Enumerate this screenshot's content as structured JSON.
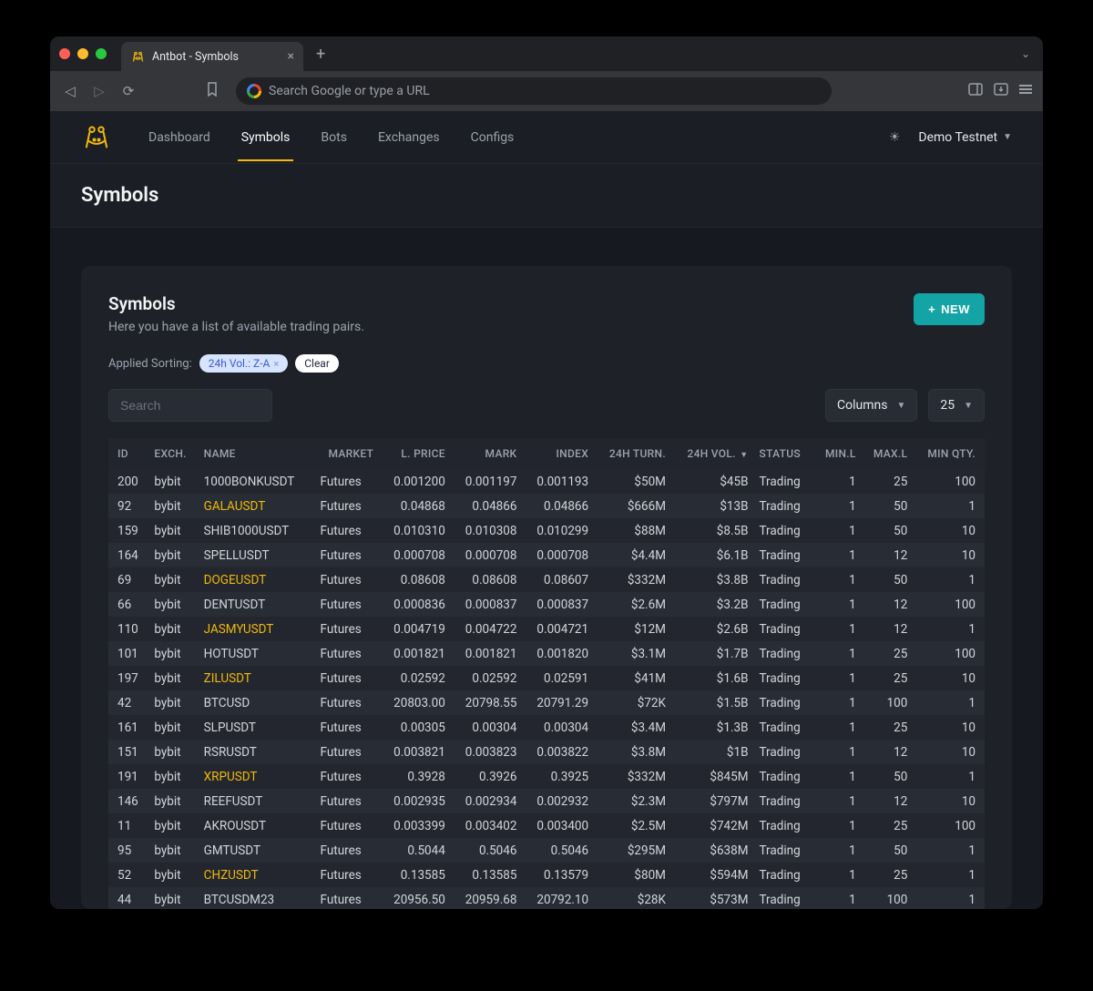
{
  "chrome": {
    "tab_title": "Antbot - Symbols",
    "omnibox_placeholder": "Search Google or type a URL"
  },
  "nav": {
    "items": [
      "Dashboard",
      "Symbols",
      "Bots",
      "Exchanges",
      "Configs"
    ],
    "active_index": 1,
    "user": "Demo Testnet"
  },
  "page": {
    "title": "Symbols",
    "card_title": "Symbols",
    "card_subtitle": "Here you have a list of available trading pairs.",
    "new_button": "NEW",
    "applied_sorting_label": "Applied Sorting:",
    "sort_pill": "24h Vol.: Z-A",
    "clear_pill": "Clear",
    "search_placeholder": "Search",
    "columns_label": "Columns",
    "page_size": "25"
  },
  "table": {
    "columns": [
      "ID",
      "EXCH.",
      "NAME",
      "MARKET",
      "L. PRICE",
      "MARK",
      "INDEX",
      "24H TURN.",
      "24H VOL.",
      "STATUS",
      "MIN.L",
      "MAX.L",
      "MIN QTY."
    ],
    "sorted_column_index": 8,
    "rows": [
      {
        "id": "200",
        "exch": "bybit",
        "name": "1000BONKUSDT",
        "hl": false,
        "market": "Futures",
        "lprice": "0.001200",
        "mark": "0.001197",
        "index": "0.001193",
        "turn": "$50M",
        "vol": "$45B",
        "status": "Trading",
        "minl": "1",
        "maxl": "25",
        "minqty": "100"
      },
      {
        "id": "92",
        "exch": "bybit",
        "name": "GALAUSDT",
        "hl": true,
        "market": "Futures",
        "lprice": "0.04868",
        "mark": "0.04866",
        "index": "0.04866",
        "turn": "$666M",
        "vol": "$13B",
        "status": "Trading",
        "minl": "1",
        "maxl": "50",
        "minqty": "1"
      },
      {
        "id": "159",
        "exch": "bybit",
        "name": "SHIB1000USDT",
        "hl": false,
        "market": "Futures",
        "lprice": "0.010310",
        "mark": "0.010308",
        "index": "0.010299",
        "turn": "$88M",
        "vol": "$8.5B",
        "status": "Trading",
        "minl": "1",
        "maxl": "50",
        "minqty": "10"
      },
      {
        "id": "164",
        "exch": "bybit",
        "name": "SPELLUSDT",
        "hl": false,
        "market": "Futures",
        "lprice": "0.000708",
        "mark": "0.000708",
        "index": "0.000708",
        "turn": "$4.4M",
        "vol": "$6.1B",
        "status": "Trading",
        "minl": "1",
        "maxl": "12",
        "minqty": "10"
      },
      {
        "id": "69",
        "exch": "bybit",
        "name": "DOGEUSDT",
        "hl": true,
        "market": "Futures",
        "lprice": "0.08608",
        "mark": "0.08608",
        "index": "0.08607",
        "turn": "$332M",
        "vol": "$3.8B",
        "status": "Trading",
        "minl": "1",
        "maxl": "50",
        "minqty": "1"
      },
      {
        "id": "66",
        "exch": "bybit",
        "name": "DENTUSDT",
        "hl": false,
        "market": "Futures",
        "lprice": "0.000836",
        "mark": "0.000837",
        "index": "0.000837",
        "turn": "$2.6M",
        "vol": "$3.2B",
        "status": "Trading",
        "minl": "1",
        "maxl": "12",
        "minqty": "100"
      },
      {
        "id": "110",
        "exch": "bybit",
        "name": "JASMYUSDT",
        "hl": true,
        "market": "Futures",
        "lprice": "0.004719",
        "mark": "0.004722",
        "index": "0.004721",
        "turn": "$12M",
        "vol": "$2.6B",
        "status": "Trading",
        "minl": "1",
        "maxl": "12",
        "minqty": "1"
      },
      {
        "id": "101",
        "exch": "bybit",
        "name": "HOTUSDT",
        "hl": false,
        "market": "Futures",
        "lprice": "0.001821",
        "mark": "0.001821",
        "index": "0.001820",
        "turn": "$3.1M",
        "vol": "$1.7B",
        "status": "Trading",
        "minl": "1",
        "maxl": "25",
        "minqty": "100"
      },
      {
        "id": "197",
        "exch": "bybit",
        "name": "ZILUSDT",
        "hl": true,
        "market": "Futures",
        "lprice": "0.02592",
        "mark": "0.02592",
        "index": "0.02591",
        "turn": "$41M",
        "vol": "$1.6B",
        "status": "Trading",
        "minl": "1",
        "maxl": "25",
        "minqty": "10"
      },
      {
        "id": "42",
        "exch": "bybit",
        "name": "BTCUSD",
        "hl": false,
        "market": "Futures",
        "lprice": "20803.00",
        "mark": "20798.55",
        "index": "20791.29",
        "turn": "$72K",
        "vol": "$1.5B",
        "status": "Trading",
        "minl": "1",
        "maxl": "100",
        "minqty": "1"
      },
      {
        "id": "161",
        "exch": "bybit",
        "name": "SLPUSDT",
        "hl": false,
        "market": "Futures",
        "lprice": "0.00305",
        "mark": "0.00304",
        "index": "0.00304",
        "turn": "$3.4M",
        "vol": "$1.3B",
        "status": "Trading",
        "minl": "1",
        "maxl": "25",
        "minqty": "10"
      },
      {
        "id": "151",
        "exch": "bybit",
        "name": "RSRUSDT",
        "hl": false,
        "market": "Futures",
        "lprice": "0.003821",
        "mark": "0.003823",
        "index": "0.003822",
        "turn": "$3.8M",
        "vol": "$1B",
        "status": "Trading",
        "minl": "1",
        "maxl": "12",
        "minqty": "10"
      },
      {
        "id": "191",
        "exch": "bybit",
        "name": "XRPUSDT",
        "hl": true,
        "market": "Futures",
        "lprice": "0.3928",
        "mark": "0.3926",
        "index": "0.3925",
        "turn": "$332M",
        "vol": "$845M",
        "status": "Trading",
        "minl": "1",
        "maxl": "50",
        "minqty": "1"
      },
      {
        "id": "146",
        "exch": "bybit",
        "name": "REEFUSDT",
        "hl": false,
        "market": "Futures",
        "lprice": "0.002935",
        "mark": "0.002934",
        "index": "0.002932",
        "turn": "$2.3M",
        "vol": "$797M",
        "status": "Trading",
        "minl": "1",
        "maxl": "12",
        "minqty": "10"
      },
      {
        "id": "11",
        "exch": "bybit",
        "name": "AKROUSDT",
        "hl": false,
        "market": "Futures",
        "lprice": "0.003399",
        "mark": "0.003402",
        "index": "0.003400",
        "turn": "$2.5M",
        "vol": "$742M",
        "status": "Trading",
        "minl": "1",
        "maxl": "25",
        "minqty": "100"
      },
      {
        "id": "95",
        "exch": "bybit",
        "name": "GMTUSDT",
        "hl": false,
        "market": "Futures",
        "lprice": "0.5044",
        "mark": "0.5046",
        "index": "0.5046",
        "turn": "$295M",
        "vol": "$638M",
        "status": "Trading",
        "minl": "1",
        "maxl": "50",
        "minqty": "1"
      },
      {
        "id": "52",
        "exch": "bybit",
        "name": "CHZUSDT",
        "hl": true,
        "market": "Futures",
        "lprice": "0.13585",
        "mark": "0.13585",
        "index": "0.13579",
        "turn": "$80M",
        "vol": "$594M",
        "status": "Trading",
        "minl": "1",
        "maxl": "25",
        "minqty": "1"
      },
      {
        "id": "44",
        "exch": "bybit",
        "name": "BTCUSDM23",
        "hl": false,
        "market": "Futures",
        "lprice": "20956.50",
        "mark": "20959.68",
        "index": "20792.10",
        "turn": "$28K",
        "vol": "$573M",
        "status": "Trading",
        "minl": "1",
        "maxl": "100",
        "minqty": "1"
      }
    ]
  }
}
